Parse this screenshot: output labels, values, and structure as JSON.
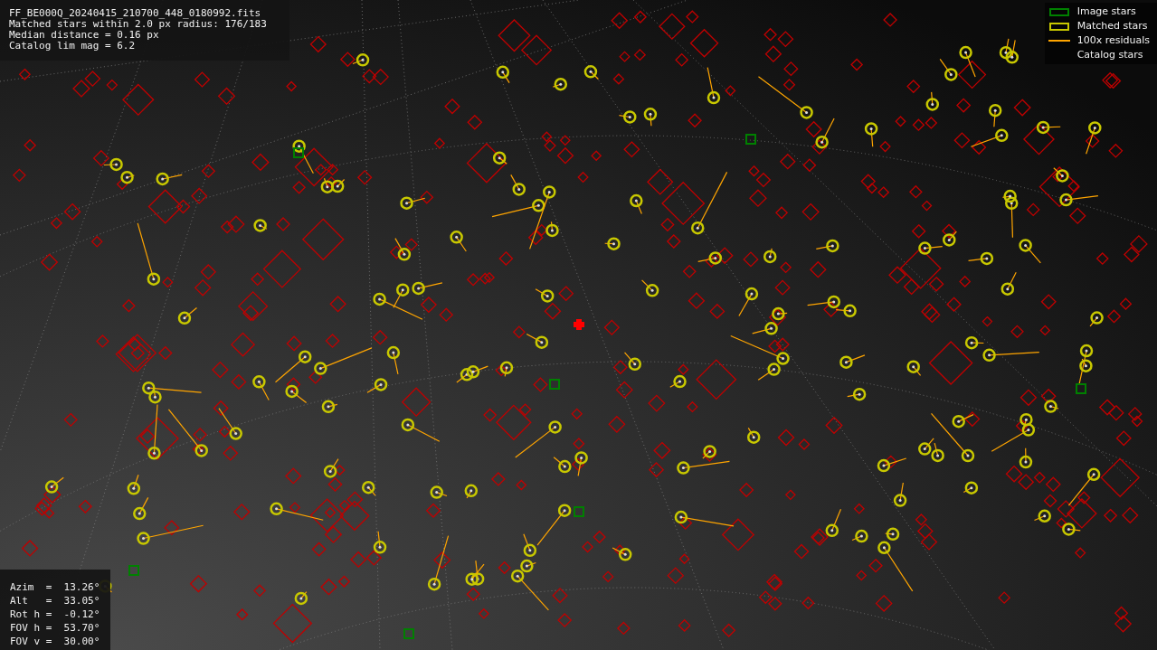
{
  "info": {
    "lines": [
      "FF_BE000Q_20240415_210700_448_0180992.fits",
      "Matched stars within 2.0 px radius: 176/183",
      "Median distance = 0.16 px",
      "Catalog lim mag = 6.2"
    ]
  },
  "legend": [
    {
      "label": "Image stars",
      "kind": "box",
      "color": "#008000"
    },
    {
      "label": "Matched stars",
      "kind": "box",
      "color": "#c8c800"
    },
    {
      "label": "100x residuals",
      "kind": "line",
      "color": "#ffa500"
    },
    {
      "label": "Catalog stars",
      "kind": "none"
    }
  ],
  "pointing": {
    "lines": [
      "Azim  =  13.26°",
      "Alt   =  33.05°",
      "Rot h =  -0.12°",
      "FOV h =  53.70°",
      "FOV v =  30.00°"
    ]
  }
}
